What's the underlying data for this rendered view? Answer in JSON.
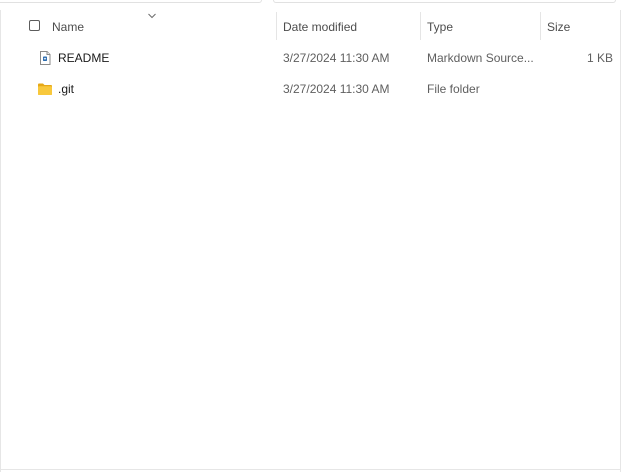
{
  "columns": {
    "name": "Name",
    "date_modified": "Date modified",
    "type": "Type",
    "size": "Size"
  },
  "icons": {
    "sort": "chevron-down-icon",
    "markdown_file": "markdown-file-icon",
    "folder": "folder-icon"
  },
  "colors": {
    "folder_yellow": "#f8c83c",
    "folder_dark": "#e6a817",
    "accent_blue": "#2b6cb0"
  },
  "rows": [
    {
      "name": "README",
      "date_modified": "3/27/2024 11:30 AM",
      "type": "Markdown Source...",
      "size": "1 KB",
      "icon": "markdown-file-icon"
    },
    {
      "name": ".git",
      "date_modified": "3/27/2024 11:30 AM",
      "type": "File folder",
      "size": "",
      "icon": "folder-icon"
    }
  ]
}
